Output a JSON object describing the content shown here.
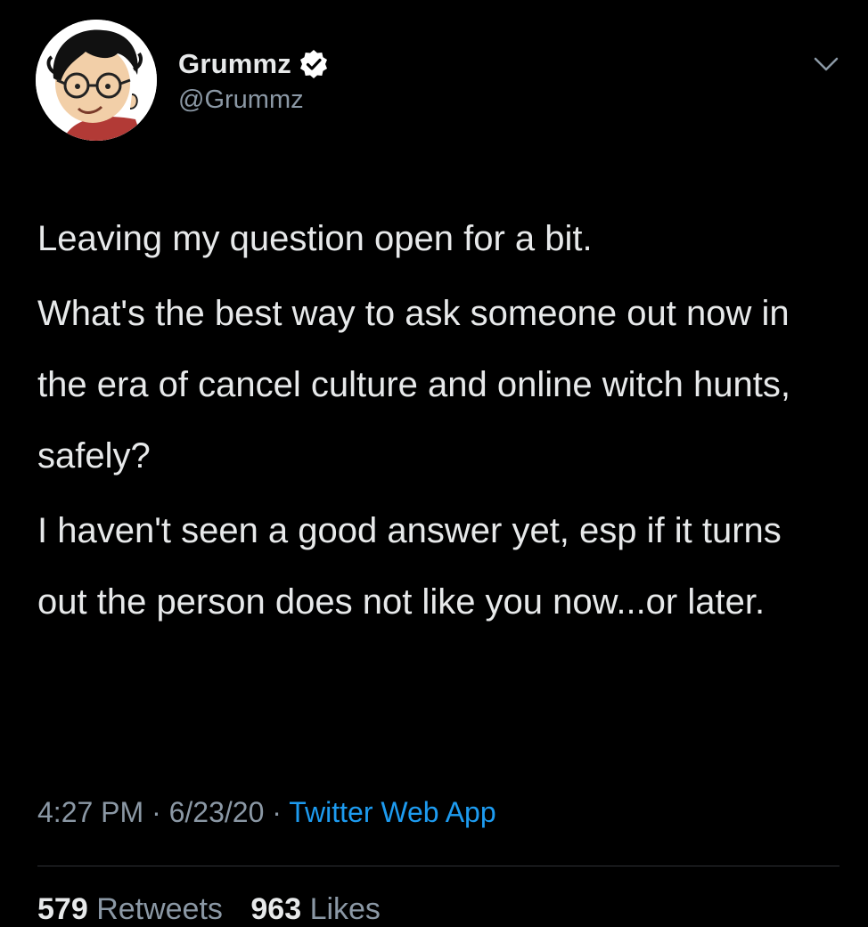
{
  "user": {
    "display_name": "Grummz",
    "handle": "@Grummz",
    "verified_icon": "verified-badge-icon",
    "avatar_icon": "cartoon-face-avatar"
  },
  "tweet": {
    "paragraphs": [
      "Leaving my question open for a bit.",
      "What's the best way to ask someone out now in the era of cancel culture and online witch hunts, safely?",
      "I haven't seen a good answer yet, esp if it turns out the person does not like you now...or later."
    ],
    "time": "4:27 PM",
    "date": "6/23/20",
    "separator": "·",
    "source": "Twitter Web App"
  },
  "stats": {
    "retweets_count": "579",
    "retweets_label": "Retweets",
    "likes_count": "963",
    "likes_label": "Likes"
  },
  "colors": {
    "background": "#000000",
    "text_primary": "#e7e9ea",
    "text_secondary": "#8b98a5",
    "accent": "#1d9bf0",
    "divider": "#2f3336"
  },
  "icons": {
    "more_menu": "chevron-down-icon"
  }
}
